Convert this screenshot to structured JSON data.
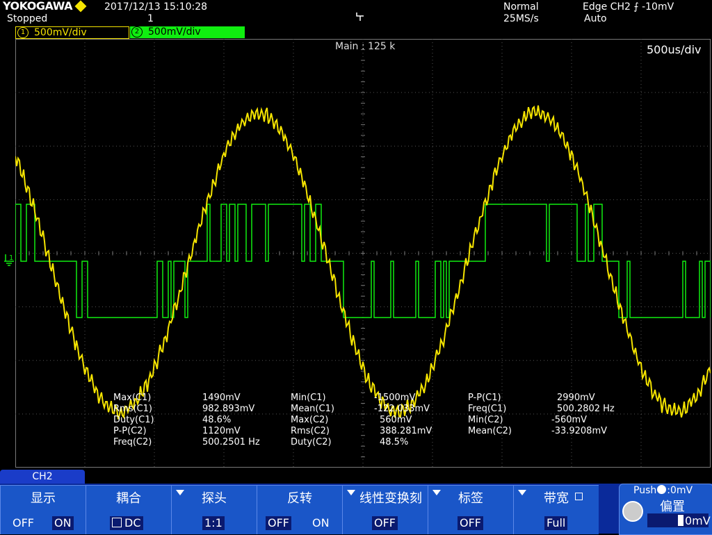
{
  "header": {
    "brand": "YOKOGAWA",
    "status": "Stopped",
    "datetime": "2017/12/13 15:10:28",
    "acq_count": "1",
    "trigger_position_icon": "trigger-position-icon",
    "acq_mode": "Normal",
    "sample_rate": "25MS/s",
    "trigger": "Edge CH2 ⨍ -10mV",
    "trigger_mode": "Auto"
  },
  "channels": {
    "ch1": {
      "num": "1",
      "label": "500mV/div",
      "color": "#f5e400"
    },
    "ch2": {
      "num": "2",
      "label": "500mV/div",
      "color": "#10ee10"
    }
  },
  "screen": {
    "main_zoom": "Main : 125 k",
    "time_div": "500us/div",
    "ground_marker": "1"
  },
  "measurements": [
    {
      "label": "Max(C1)",
      "value": "1490mV"
    },
    {
      "label": "Min(C1)",
      "value": "-1500mV"
    },
    {
      "label": "P-P(C1)",
      "value": "2990mV"
    },
    {
      "label": "Rms(C1)",
      "value": "982.893mV"
    },
    {
      "label": "Mean(C1)",
      "value": "-122.033mV"
    },
    {
      "label": "Freq(C1)",
      "value": "500.2802 Hz"
    },
    {
      "label": "Duty(C1)",
      "value": "48.6%"
    },
    {
      "label": "Max(C2)",
      "value": "560mV"
    },
    {
      "label": "Min(C2)",
      "value": "-560mV"
    },
    {
      "label": "P-P(C2)",
      "value": "1120mV"
    },
    {
      "label": "Rms(C2)",
      "value": "388.281mV"
    },
    {
      "label": "Mean(C2)",
      "value": "-33.9208mV"
    },
    {
      "label": "Freq(C2)",
      "value": "500.2501 Hz"
    },
    {
      "label": "Duty(C2)",
      "value": "48.5%"
    }
  ],
  "menu": {
    "tab": "CH2",
    "display": {
      "title": "显示",
      "off": "OFF",
      "on": "ON"
    },
    "coupling": {
      "title": "耦合",
      "value": "DC"
    },
    "probe": {
      "title": "探头",
      "value": "1:1"
    },
    "invert": {
      "title": "反转",
      "off": "OFF",
      "on": "ON"
    },
    "linear_scale": {
      "title": "线性变换刻",
      "value": "OFF"
    },
    "label": {
      "title": "标签",
      "value": "OFF"
    },
    "bandwidth": {
      "title": "带宽",
      "value": "Full"
    },
    "offset": {
      "push": "Push",
      "push_value": ":0mV",
      "title": "偏置",
      "value": "0mV"
    }
  },
  "colors": {
    "background": "#000000",
    "grid": "#7a7a7a",
    "ch1": "#f5e400",
    "ch2": "#10ee10",
    "menu": "#1a56c8"
  }
}
